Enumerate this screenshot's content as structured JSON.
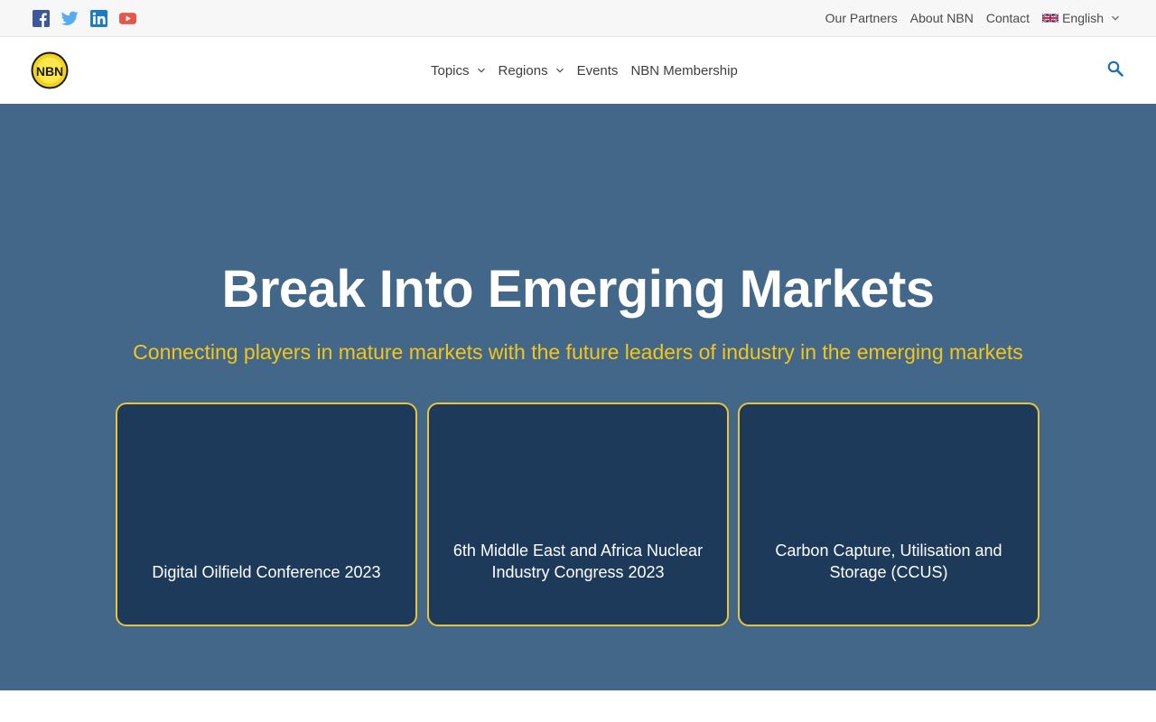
{
  "social": {
    "icons": [
      "facebook-icon",
      "twitter-icon",
      "linkedin-icon",
      "youtube-icon"
    ],
    "colors": {
      "facebook": "#3b5998",
      "twitter": "#55acee",
      "linkedin": "#1d7bbf",
      "youtube": "#e5574b"
    }
  },
  "toplinks": {
    "partners": "Our Partners",
    "about": "About NBN",
    "contact": "Contact",
    "language": "English"
  },
  "nav": {
    "topics": "Topics",
    "regions": "Regions",
    "events": "Events",
    "membership": "NBN Membership"
  },
  "logo": {
    "text": "NBN"
  },
  "hero": {
    "title": "Break Into Emerging Markets",
    "subtitle": "Connecting players in mature markets with the future leaders of industry in the emerging markets",
    "cards": [
      {
        "title": "Digital Oilfield Conference 2023"
      },
      {
        "title": "6th Middle East and Africa Nuclear Industry Congress 2023"
      },
      {
        "title": "Carbon Capture, Utilisation and Storage (CCUS)"
      }
    ]
  },
  "colors": {
    "hero_bg": "#426789",
    "card_bg": "#1e3a5a",
    "card_border": "#e8c43a",
    "subtitle": "#f5c518",
    "search_icon": "#1e6fb5"
  }
}
